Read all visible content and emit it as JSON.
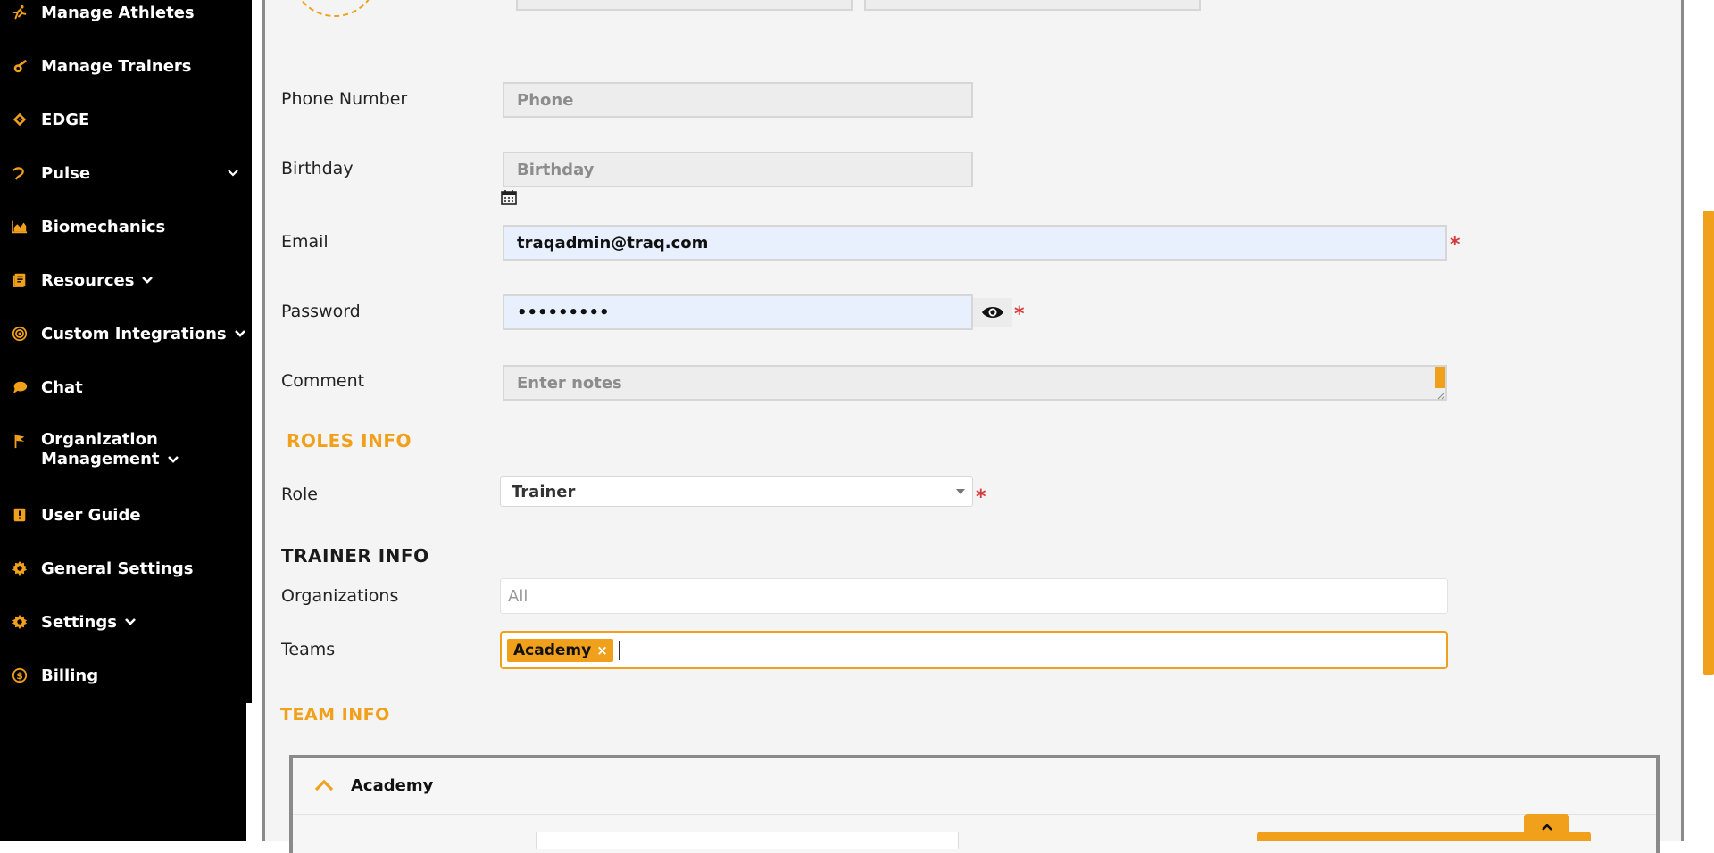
{
  "sidebar": {
    "items": [
      {
        "label": "Manage Athletes",
        "icon": "runner-icon"
      },
      {
        "label": "Manage Trainers",
        "icon": "whistle-icon"
      },
      {
        "label": "EDGE",
        "icon": "edge-icon"
      },
      {
        "label": "Pulse",
        "icon": "pulse-icon"
      },
      {
        "label": "Biomechanics",
        "icon": "area-chart-icon"
      },
      {
        "label": "Resources",
        "icon": "book-icon"
      },
      {
        "label": "Custom Integrations",
        "icon": "target-icon"
      },
      {
        "label": "Chat",
        "icon": "chat-bubble-icon"
      },
      {
        "label_line1": "Organization",
        "label_line2": "Management",
        "icon": "flag-icon"
      },
      {
        "label": "User Guide",
        "icon": "guide-book-icon"
      },
      {
        "label": "General Settings",
        "icon": "gear-icon"
      },
      {
        "label": "Settings",
        "icon": "gear-icon"
      },
      {
        "label": "Billing",
        "icon": "dollar-coin-icon"
      }
    ]
  },
  "form": {
    "phone": {
      "label": "Phone Number",
      "placeholder": "Phone"
    },
    "birthday": {
      "label": "Birthday",
      "placeholder": "Birthday"
    },
    "email": {
      "label": "Email",
      "value": "traqadmin@traq.com"
    },
    "password": {
      "label": "Password",
      "value": "•••••••••"
    },
    "comment": {
      "label": "Comment",
      "placeholder": "Enter notes"
    },
    "required_mark": "*"
  },
  "roles_info": {
    "title": "ROLES INFO",
    "role_label": "Role",
    "role_value": "Trainer"
  },
  "trainer_info": {
    "title": "TRAINER INFO",
    "organizations_label": "Organizations",
    "organizations_value": "All",
    "teams_label": "Teams",
    "teams": [
      {
        "label": "Academy",
        "remove": "×"
      }
    ]
  },
  "team_info": {
    "title": "TEAM INFO",
    "team_name": "Academy"
  },
  "colors": {
    "accent": "#f0a01b",
    "sidebar_bg": "#000000",
    "required": "#d43a3a"
  }
}
